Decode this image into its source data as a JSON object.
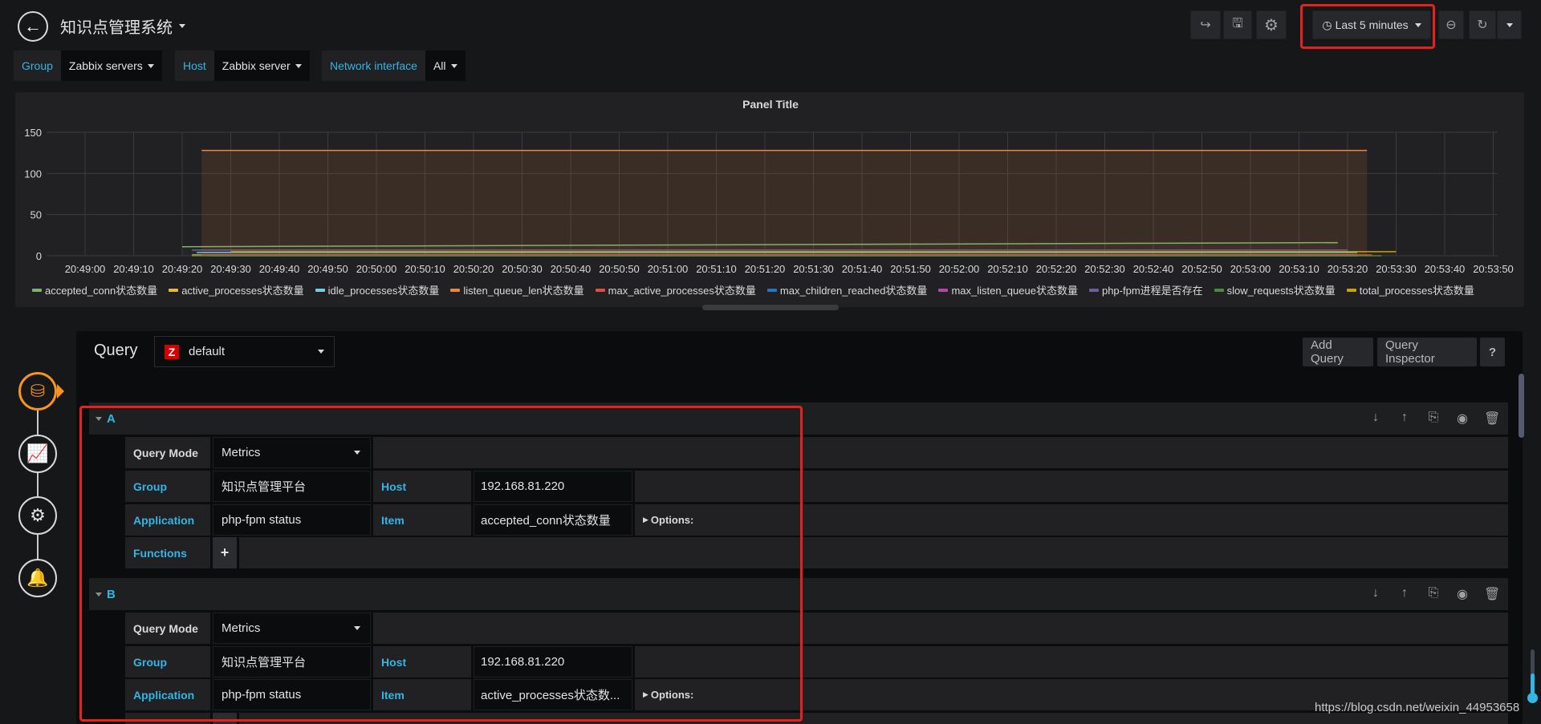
{
  "dashboard": {
    "title": "知识点管理系统"
  },
  "toolbar": {
    "share_icon": "share-icon",
    "save_icon": "save-icon",
    "settings_icon": "gear-icon",
    "time_range": "Last 5 minutes",
    "zoom_out_icon": "zoom-out-icon",
    "refresh_icon": "refresh-icon"
  },
  "variables": [
    {
      "label": "Group",
      "value": "Zabbix servers"
    },
    {
      "label": "Host",
      "value": "Zabbix server"
    },
    {
      "label": "Network interface",
      "value": "All"
    }
  ],
  "panel": {
    "title": "Panel Title"
  },
  "chart_data": {
    "type": "line",
    "title": "Panel Title",
    "xlabel": "",
    "ylabel": "",
    "ylim": [
      0,
      150
    ],
    "yticks": [
      "0",
      "50",
      "100",
      "150"
    ],
    "xticks": [
      "20:49:00",
      "20:49:10",
      "20:49:20",
      "20:49:30",
      "20:49:40",
      "20:49:50",
      "20:50:00",
      "20:50:10",
      "20:50:20",
      "20:50:30",
      "20:50:40",
      "20:50:50",
      "20:51:00",
      "20:51:10",
      "20:51:20",
      "20:51:30",
      "20:51:40",
      "20:51:50",
      "20:52:00",
      "20:52:10",
      "20:52:20",
      "20:52:30",
      "20:52:40",
      "20:52:50",
      "20:53:00",
      "20:53:10",
      "20:53:20",
      "20:53:30",
      "20:53:40",
      "20:53:50"
    ],
    "grid": true,
    "legend_position": "bottom",
    "series": [
      {
        "name": "accepted_conn状态数量",
        "color": "#7eb26d",
        "start": "20:49:20",
        "end": "20:53:18",
        "value": 11,
        "end_value": 16
      },
      {
        "name": "active_processes状态数量",
        "color": "#eab839",
        "start": "20:49:22",
        "end": "20:53:22",
        "value": 1
      },
      {
        "name": "idle_processes状态数量",
        "color": "#6ed0e0",
        "start": "20:49:23",
        "end": "20:53:22",
        "value": 4
      },
      {
        "name": "listen_queue_len状态数量",
        "color": "#ef843c",
        "start": "20:49:24",
        "end": "20:53:24",
        "value": 128,
        "filled": true
      },
      {
        "name": "max_active_processes状态数量",
        "color": "#e24d42",
        "start": "20:49:24",
        "end": "20:53:25",
        "value": 1
      },
      {
        "name": "max_children_reached状态数量",
        "color": "#1f78c1",
        "start": "20:49:25",
        "end": "20:53:22",
        "value": 0
      },
      {
        "name": "max_listen_queue状态数量",
        "color": "#ba43a9",
        "start": "20:49:26",
        "end": "20:53:22",
        "value": 0
      },
      {
        "name": "php-fpm进程是否存在",
        "color": "#705da0",
        "start": "20:49:22",
        "end": "20:53:20",
        "value": 7
      },
      {
        "name": "slow_requests状态数量",
        "color": "#508642",
        "start": "20:49:22",
        "end": "20:53:27",
        "value": 0
      },
      {
        "name": "total_processes状态数量",
        "color": "#cca300",
        "start": "20:49:30",
        "end": "20:53:30",
        "value": 5
      }
    ]
  },
  "query_editor": {
    "title": "Query",
    "datasource": "default",
    "datasource_logo": "Z",
    "add_query": "Add Query",
    "query_inspector": "Query Inspector",
    "help": "?",
    "queries": [
      {
        "ref": "A",
        "query_mode_label": "Query Mode",
        "query_mode": "Metrics",
        "group_label": "Group",
        "group": "知识点管理平台",
        "host_label": "Host",
        "host": "192.168.81.220",
        "application_label": "Application",
        "application": "php-fpm status",
        "item_label": "Item",
        "item": "accepted_conn状态数量",
        "options_label": "Options:",
        "functions_label": "Functions",
        "add_function": "+"
      },
      {
        "ref": "B",
        "query_mode_label": "Query Mode",
        "query_mode": "Metrics",
        "group_label": "Group",
        "group": "知识点管理平台",
        "host_label": "Host",
        "host": "192.168.81.220",
        "application_label": "Application",
        "application": "php-fpm status",
        "item_label": "Item",
        "item": "active_processes状态数...",
        "options_label": "Options:"
      }
    ]
  },
  "watermark": "https://blog.csdn.net/weixin_44953658"
}
